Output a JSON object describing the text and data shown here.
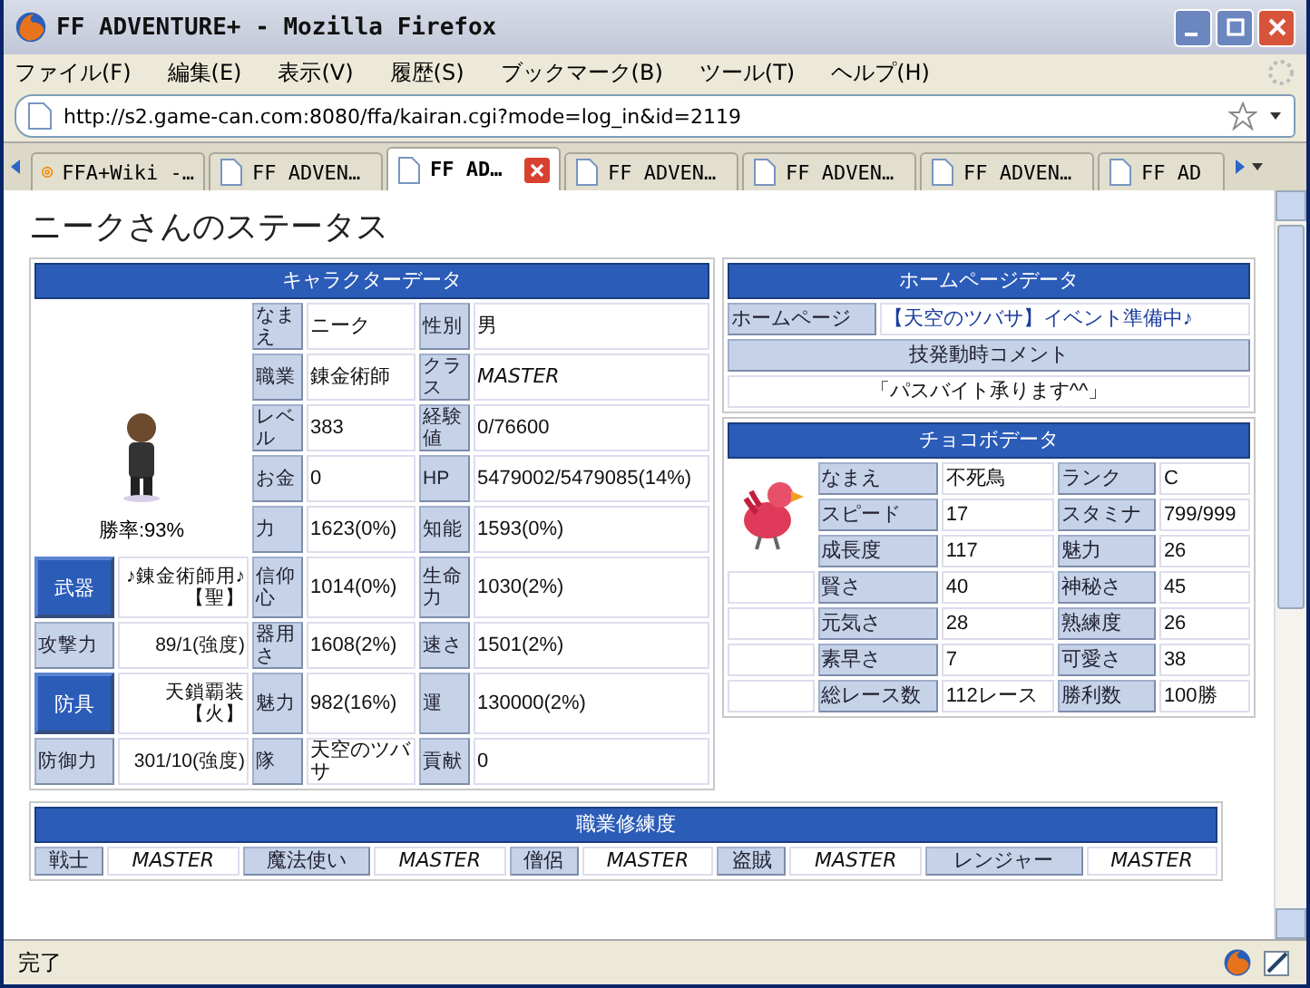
{
  "window": {
    "title": "FF ADVENTURE+ - Mozilla Firefox"
  },
  "menu": [
    "ファイル(F)",
    "編集(E)",
    "表示(V)",
    "履歴(S)",
    "ブックマーク(B)",
    "ツール(T)",
    "ヘルプ(H)"
  ],
  "address_bar": {
    "value": "http://s2.game-can.com:8080/ffa/kairan.cgi?mode=log_in&id=2119"
  },
  "tabs": [
    {
      "label": "FFA+Wiki -…",
      "kind": "wiki",
      "selected": false
    },
    {
      "label": "FF ADVEN…",
      "kind": "page",
      "selected": false
    },
    {
      "label": "FF AD…",
      "kind": "page",
      "selected": true
    },
    {
      "label": "FF ADVEN…",
      "kind": "page",
      "selected": false
    },
    {
      "label": "FF ADVEN…",
      "kind": "page",
      "selected": false
    },
    {
      "label": "FF ADVEN…",
      "kind": "page",
      "selected": false
    },
    {
      "label": "FF AD",
      "kind": "page",
      "selected": false
    }
  ],
  "page": {
    "heading": "ニークさんのステータス"
  },
  "character_data": {
    "title": "キャラクターデータ",
    "win_rate": "勝率:93%",
    "profile_rows": [
      {
        "stats": [
          {
            "label": "なまえ",
            "value": "ニーク",
            "kind": "plain"
          },
          {
            "label": "性別",
            "value": "男",
            "kind": "plain"
          }
        ]
      },
      {
        "stats": [
          {
            "label": "職業",
            "value": "錬金術師",
            "kind": "plain"
          },
          {
            "label": "クラス",
            "value": "MASTER",
            "kind": "rank"
          }
        ]
      },
      {
        "stats": [
          {
            "label": "レベル",
            "value": "383",
            "kind": "plain"
          },
          {
            "label": "経験値",
            "value": "0/76600",
            "kind": "plain"
          }
        ]
      },
      {
        "stats": [
          {
            "label": "お金",
            "value": "0",
            "kind": "plain"
          },
          {
            "label": "HP",
            "value": "5479002/5479085(14%)",
            "kind": "plain"
          }
        ]
      },
      {
        "stats": [
          {
            "label": "力",
            "value": "1623(0%)",
            "kind": "plain"
          },
          {
            "label": "知能",
            "value": "1593(0%)",
            "kind": "plain"
          }
        ]
      }
    ],
    "equipment_rows": [
      {
        "label": "武器",
        "value": "♪錬金術師用♪【聖】",
        "kind": "button",
        "stats": [
          {
            "label": "信仰心",
            "value": "1014(0%)",
            "kind": "plain"
          },
          {
            "label": "生命力",
            "value": "1030(2%)",
            "kind": "plain"
          }
        ]
      },
      {
        "label": "攻撃力",
        "value": "89/1(強度)",
        "kind": "label",
        "stats": [
          {
            "label": "器用さ",
            "value": "1608(2%)",
            "kind": "plain"
          },
          {
            "label": "速さ",
            "value": "1501(2%)",
            "kind": "plain"
          }
        ]
      },
      {
        "label": "防具",
        "value": "天鎖覇装【火】",
        "kind": "button",
        "stats": [
          {
            "label": "魅力",
            "value": "982(16%)",
            "kind": "plain"
          },
          {
            "label": "運",
            "value": "130000(2%)",
            "kind": "plain"
          }
        ]
      },
      {
        "label": "防御力",
        "value": "301/10(強度)",
        "kind": "label",
        "stats": [
          {
            "label": "隊",
            "value": "天空のツバサ",
            "kind": "plain"
          },
          {
            "label": "貢献",
            "value": "0",
            "kind": "plain"
          }
        ]
      }
    ]
  },
  "homepage_data": {
    "title": "ホームページデータ",
    "label": "ホームページ",
    "value": "【天空のツバサ】イベント準備中♪",
    "comment_title": "技発動時コメント",
    "comment": "「パスバイト承ります^^」"
  },
  "chocobo_data": {
    "title": "チョコボデータ",
    "rows": [
      [
        {
          "label": "なまえ",
          "value": "不死鳥"
        },
        {
          "label": "ランク",
          "value": "C"
        }
      ],
      [
        {
          "label": "スピード",
          "value": "17"
        },
        {
          "label": "スタミナ",
          "value": "799/999"
        }
      ],
      [
        {
          "label": "成長度",
          "value": "117"
        },
        {
          "label": "魅力",
          "value": "26"
        }
      ],
      [
        {
          "label": "賢さ",
          "value": "40"
        },
        {
          "label": "神秘さ",
          "value": "45"
        }
      ],
      [
        {
          "label": "元気さ",
          "value": "28"
        },
        {
          "label": "熟練度",
          "value": "26"
        }
      ],
      [
        {
          "label": "素早さ",
          "value": "7"
        },
        {
          "label": "可愛さ",
          "value": "38"
        }
      ],
      [
        {
          "label": "総レース数",
          "value": "112レース"
        },
        {
          "label": "勝利数",
          "value": "100勝"
        }
      ]
    ]
  },
  "job_mastery": {
    "title": "職業修練度",
    "jobs": [
      {
        "name": "戦士",
        "rank": "MASTER"
      },
      {
        "name": "魔法使い",
        "rank": "MASTER"
      },
      {
        "name": "僧侶",
        "rank": "MASTER"
      },
      {
        "name": "盗賊",
        "rank": "MASTER"
      },
      {
        "name": "レンジャー",
        "rank": "MASTER"
      }
    ]
  },
  "status_bar": {
    "text": "完了"
  }
}
